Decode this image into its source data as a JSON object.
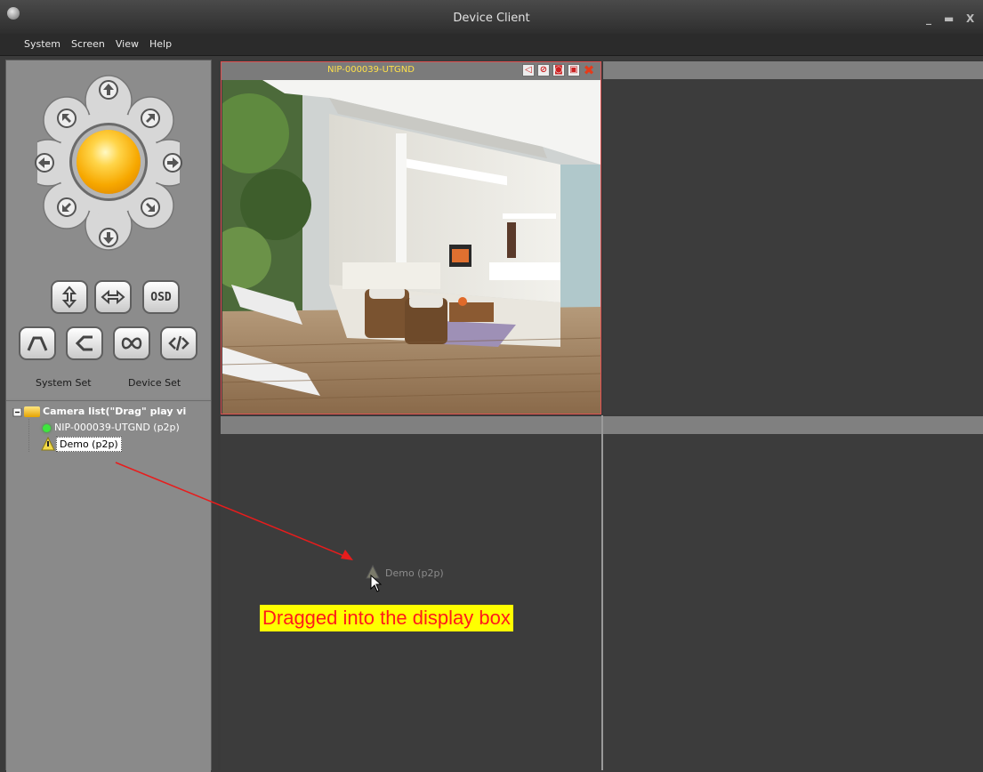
{
  "window": {
    "title": "Device Client",
    "minimize": "_",
    "maximize": "▬",
    "close": "X"
  },
  "menu": [
    "System",
    "Screen",
    "View",
    "Help"
  ],
  "sidebar": {
    "system_set": "System Set",
    "device_set": "Device Set",
    "osd_label": "OSD",
    "tree": {
      "root": "Camera list(\"Drag\" play vi",
      "items": [
        {
          "label": "NIP-000039-UTGND (p2p)",
          "status": "online"
        },
        {
          "label": "Demo (p2p)",
          "status": "selected"
        }
      ]
    }
  },
  "camera_view": {
    "active_camera": "NIP-000039-UTGND",
    "drag_ghost_label": "Demo (p2p)"
  },
  "annotation": {
    "text": "Dragged into the display box"
  },
  "colors": {
    "annotation_bg": "#ffff00",
    "annotation_text": "#ff1a1a",
    "camera_name": "#ffe14a",
    "active_border": "#e05050"
  }
}
